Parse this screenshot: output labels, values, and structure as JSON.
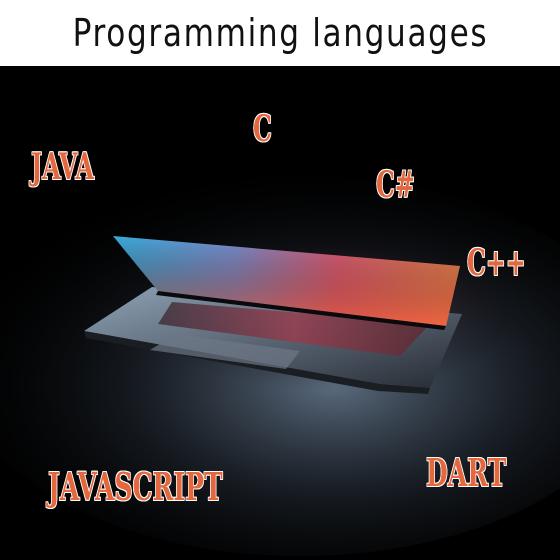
{
  "title": "Programming languages",
  "languages": {
    "java": "JAVA",
    "c": "C",
    "csharp": "C#",
    "cpp": "C++",
    "javascript": "JAVASCRIPT",
    "dart": "DART"
  },
  "colors": {
    "label": "#e3683e",
    "label_outline": "#ffffff",
    "background": "#000000",
    "title_bar": "#ffffff"
  }
}
